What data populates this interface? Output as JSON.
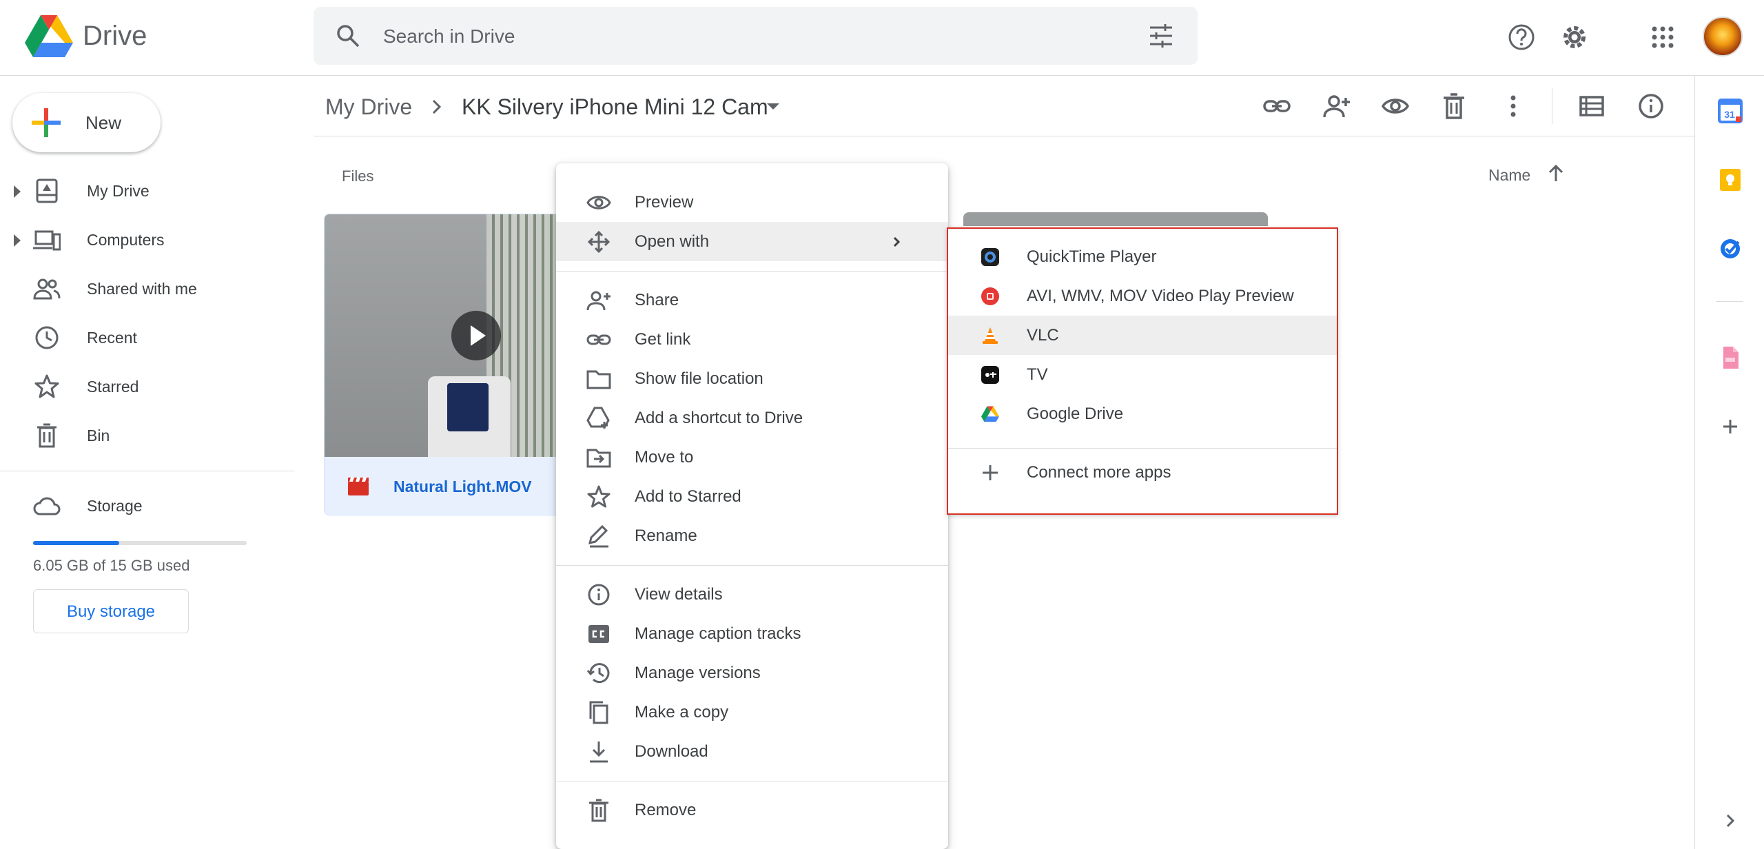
{
  "header": {
    "app_name": "Drive",
    "search_placeholder": "Search in Drive",
    "icons": [
      "drive-logo",
      "search-icon",
      "search-options-icon",
      "help-icon",
      "settings-icon",
      "apps-grid-icon",
      "account-avatar"
    ]
  },
  "sidebar": {
    "new_label": "New",
    "items": [
      {
        "label": "My Drive",
        "icon": "my-drive-icon",
        "expandable": true
      },
      {
        "label": "Computers",
        "icon": "computers-icon",
        "expandable": true
      },
      {
        "label": "Shared with me",
        "icon": "shared-icon",
        "expandable": false
      },
      {
        "label": "Recent",
        "icon": "clock-icon",
        "expandable": false
      },
      {
        "label": "Starred",
        "icon": "star-icon",
        "expandable": false
      },
      {
        "label": "Bin",
        "icon": "trash-icon",
        "expandable": false
      }
    ],
    "storage": {
      "label": "Storage",
      "used_text": "6.05 GB of 15 GB used",
      "used_fraction": 0.403,
      "buy_label": "Buy storage"
    }
  },
  "breadcrumb": {
    "root": "My Drive",
    "current": "KK Silvery iPhone Mini 12 Cam"
  },
  "toolbar": {
    "icons": [
      "link-icon",
      "add-person-icon",
      "preview-icon",
      "trash-icon",
      "more-vert-icon",
      "list-view-icon",
      "info-icon"
    ]
  },
  "content": {
    "section_label": "Files",
    "sort_label": "Name",
    "file": {
      "name": "Natural Light.MOV",
      "icon": "video-file-icon"
    }
  },
  "context_menu": {
    "items": [
      {
        "label": "Preview",
        "icon": "eye-icon"
      },
      {
        "label": "Open with",
        "icon": "open-with-icon",
        "submenu": true,
        "highlighted": true
      },
      {
        "label": "Share",
        "icon": "add-person-icon"
      },
      {
        "label": "Get link",
        "icon": "link-icon"
      },
      {
        "label": "Show file location",
        "icon": "folder-icon"
      },
      {
        "label": "Add a shortcut to Drive",
        "icon": "shortcut-icon"
      },
      {
        "label": "Move to",
        "icon": "move-icon"
      },
      {
        "label": "Add to Starred",
        "icon": "star-icon"
      },
      {
        "label": "Rename",
        "icon": "pencil-icon"
      },
      {
        "label": "View details",
        "icon": "info-icon"
      },
      {
        "label": "Manage caption tracks",
        "icon": "cc-icon"
      },
      {
        "label": "Manage versions",
        "icon": "history-icon"
      },
      {
        "label": "Make a copy",
        "icon": "copy-icon"
      },
      {
        "label": "Download",
        "icon": "download-icon"
      },
      {
        "label": "Remove",
        "icon": "trash-icon"
      }
    ]
  },
  "open_with_submenu": {
    "items": [
      {
        "label": "QuickTime Player",
        "icon": "quicktime-icon"
      },
      {
        "label": "AVI, WMV, MOV Video Play Preview",
        "icon": "video-play-icon"
      },
      {
        "label": "VLC",
        "icon": "vlc-icon",
        "highlighted": true
      },
      {
        "label": "TV",
        "icon": "apple-tv-icon"
      },
      {
        "label": "Google Drive",
        "icon": "google-drive-icon"
      }
    ],
    "connect_label": "Connect more apps"
  },
  "side_panel": {
    "icons": [
      "calendar-icon",
      "keep-icon",
      "tasks-icon",
      "pdf-addon-icon",
      "add-icon",
      "expand-panel-icon"
    ],
    "calendar_day": "31"
  },
  "colors": {
    "accent": "#1a73e8",
    "highlight_border": "#d93025",
    "menu_hover": "#eeeeee"
  }
}
